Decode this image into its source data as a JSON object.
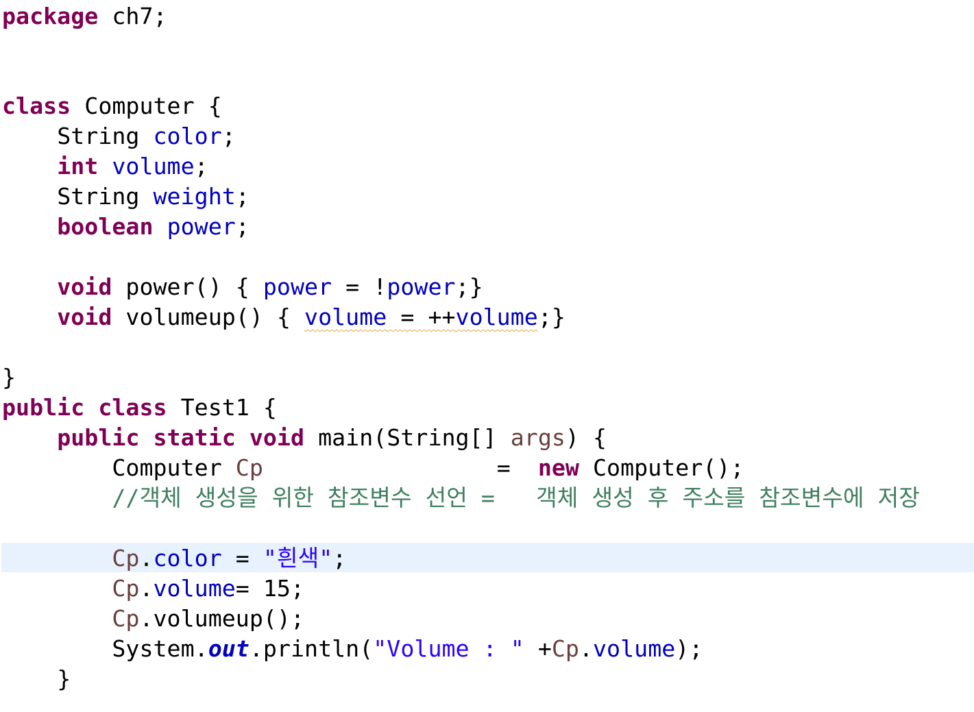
{
  "code": {
    "line1": {
      "kw": "package",
      "rest": " ch7;"
    },
    "line4": {
      "kw": "class",
      "rest": " Computer {"
    },
    "line5": {
      "type": "String",
      "field": "color",
      "end": ";"
    },
    "line6": {
      "kw": "int",
      "field": "volume",
      "end": ";"
    },
    "line7": {
      "type": "String",
      "field": "weight",
      "end": ";"
    },
    "line8": {
      "kw": "boolean",
      "field": "power",
      "end": ";"
    },
    "line10": {
      "kw": "void",
      "name": " power() { ",
      "field1": "power",
      "op": " = !",
      "field2": "power",
      "end": ";}"
    },
    "line11": {
      "kw": "void",
      "name": " volumeup() { ",
      "field1": "volume",
      "op": " = ++",
      "field2": "volume",
      "end": ";}"
    },
    "line13": {
      "brace": "}"
    },
    "line14": {
      "kw1": "public",
      "kw2": "class",
      "rest": " Test1 {"
    },
    "line15": {
      "kw1": "public",
      "kw2": "static",
      "kw3": "void",
      "sig": " main(String[] ",
      "param": "args",
      "end": ") {"
    },
    "line16": {
      "type": "Computer",
      "var": "Cp",
      "eq": "=",
      "kw": "new",
      "rest": " Computer();"
    },
    "line17": {
      "comment1": "//객체 생성을 위한 참조변수 선언 =",
      "comment2": "객체 생성 후 주소를 참조변수에 저장"
    },
    "line19": {
      "var": "Cp",
      "dot": ".",
      "field": "color",
      "op": " = ",
      "str": "\"흰색\"",
      "end": ";"
    },
    "line20": {
      "var": "Cp",
      "dot": ".",
      "field": "volume",
      "op": "= 15;"
    },
    "line21": {
      "var": "Cp",
      "rest": ".volumeup();"
    },
    "line22": {
      "sys": "System.",
      "out": "out",
      "call": ".println(",
      "str": "\"Volume : \"",
      "plus": " +",
      "var": "Cp",
      "dot": ".",
      "field": "volume",
      "end": ");"
    },
    "line23": {
      "brace": "}"
    }
  },
  "colors": {
    "keyword": "#7f0055",
    "field": "#0000c0",
    "local_variable": "#6a3e3e",
    "string": "#2a00ff",
    "comment": "#3f7f5f",
    "current_line": "#e8f2fe",
    "warning_underline": "#e8a33d"
  }
}
